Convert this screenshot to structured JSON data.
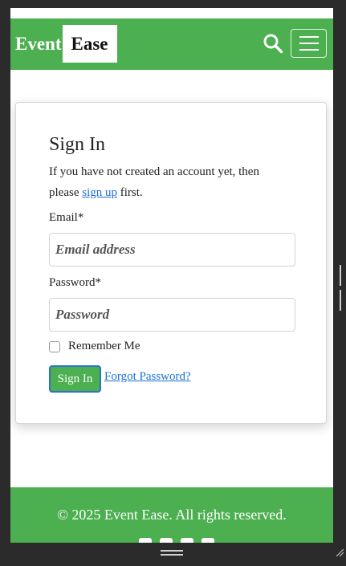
{
  "navbar": {
    "brand_part1": "Event",
    "brand_part2": "Ease",
    "search_icon": "search-icon",
    "menu_icon": "hamburger-menu-icon"
  },
  "signin": {
    "title": "Sign In",
    "intro_before": "If you have not created an account yet, then please ",
    "signup_link": "sign up",
    "intro_after": " first.",
    "email_label": "Email*",
    "email_placeholder": "Email address",
    "email_value": "",
    "password_label": "Password*",
    "password_placeholder": "Password",
    "password_value": "",
    "remember_label": "Remember Me",
    "remember_checked": false,
    "submit_label": "Sign In",
    "forgot_link": "Forgot Password?"
  },
  "footer": {
    "copyright": "© 2025 Event Ease. All rights reserved.",
    "social_icons": [
      "facebook-icon",
      "instagram-icon",
      "x-icon",
      "linkedin-icon"
    ]
  },
  "colors": {
    "brand_green": "#4caf50",
    "link_blue": "#1a6fd6",
    "chrome_dark": "#2b2b2b"
  }
}
